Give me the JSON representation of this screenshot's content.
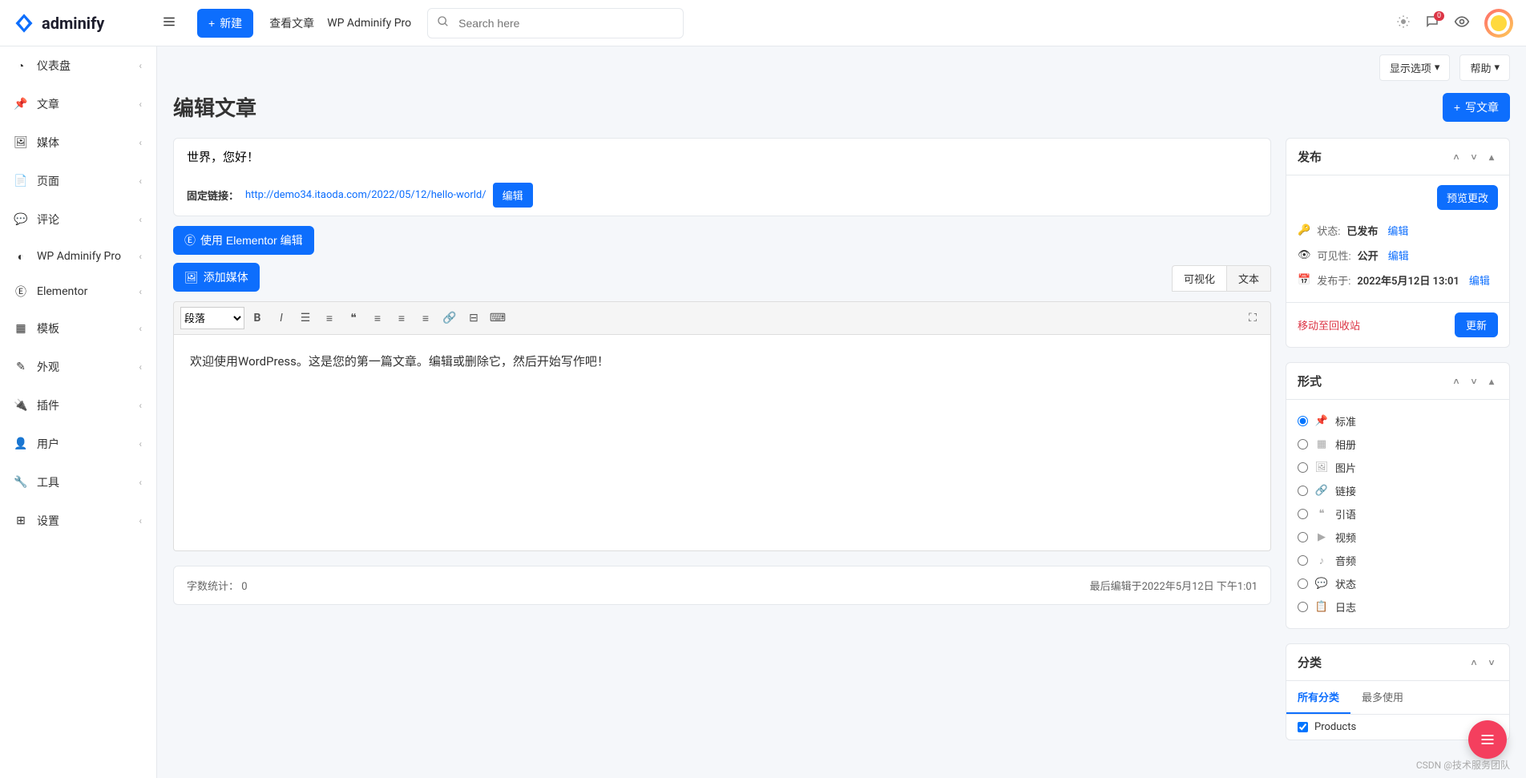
{
  "brand": "adminify",
  "topbar": {
    "new_btn": "新建",
    "links": [
      "查看文章",
      "WP Adminify Pro"
    ],
    "search_placeholder": "Search here",
    "comment_badge": "0"
  },
  "sidebar": {
    "items": [
      {
        "label": "仪表盘",
        "icon": "gauge"
      },
      {
        "label": "文章",
        "icon": "pin"
      },
      {
        "label": "媒体",
        "icon": "media"
      },
      {
        "label": "页面",
        "icon": "page"
      },
      {
        "label": "评论",
        "icon": "comment"
      },
      {
        "label": "WP Adminify Pro",
        "icon": "adminify"
      },
      {
        "label": "Elementor",
        "icon": "elementor"
      },
      {
        "label": "模板",
        "icon": "template"
      },
      {
        "label": "外观",
        "icon": "brush"
      },
      {
        "label": "插件",
        "icon": "plug"
      },
      {
        "label": "用户",
        "icon": "user"
      },
      {
        "label": "工具",
        "icon": "wrench"
      },
      {
        "label": "设置",
        "icon": "settings"
      }
    ]
  },
  "screen_options": {
    "display": "显示选项",
    "help": "帮助"
  },
  "page": {
    "title": "编辑文章",
    "add_new": "写文章",
    "post_title": "世界，您好！",
    "permalink_label": "固定链接：",
    "permalink_url": "http://demo34.itaoda.com/2022/05/12/hello-world/",
    "permalink_edit": "编辑",
    "elementor_btn": "使用 Elementor 编辑",
    "add_media": "添加媒体",
    "tabs": {
      "visual": "可视化",
      "text": "文本"
    },
    "format_dropdown": "段落",
    "content": "欢迎使用WordPress。这是您的第一篇文章。编辑或删除它，然后开始写作吧！",
    "wordcount_label": "字数统计：",
    "wordcount": "0",
    "last_edited": "最后编辑于2022年5月12日 下午1:01"
  },
  "publish": {
    "title": "发布",
    "preview": "预览更改",
    "status_label": "状态:",
    "status_val": "已发布",
    "visibility_label": "可见性:",
    "visibility_val": "公开",
    "date_label": "发布于:",
    "date_val": "2022年5月12日 13:01",
    "edit_link": "编辑",
    "trash": "移动至回收站",
    "update": "更新"
  },
  "format": {
    "title": "形式",
    "options": [
      {
        "label": "标准",
        "icon": "pin",
        "checked": true
      },
      {
        "label": "相册",
        "icon": "gallery"
      },
      {
        "label": "图片",
        "icon": "image"
      },
      {
        "label": "链接",
        "icon": "link"
      },
      {
        "label": "引语",
        "icon": "quote"
      },
      {
        "label": "视频",
        "icon": "video"
      },
      {
        "label": "音频",
        "icon": "audio"
      },
      {
        "label": "状态",
        "icon": "status"
      },
      {
        "label": "日志",
        "icon": "aside"
      }
    ]
  },
  "category": {
    "title": "分类",
    "tabs": {
      "all": "所有分类",
      "popular": "最多使用"
    },
    "items": [
      {
        "label": "Products",
        "checked": true
      }
    ]
  },
  "watermark": "CSDN @技术服务团队"
}
